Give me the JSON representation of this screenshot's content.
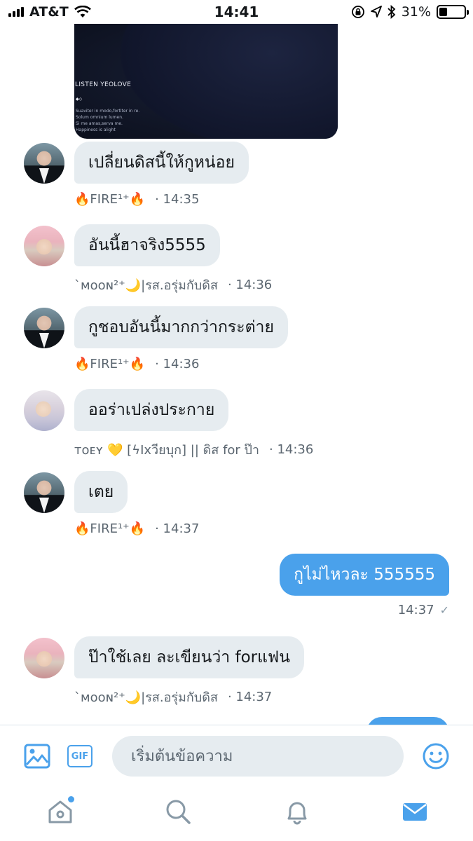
{
  "status_bar": {
    "carrier": "AT&T",
    "time": "14:41",
    "battery_text": "31%",
    "battery_level": 0.31,
    "icons": [
      "signal-bars-icon",
      "wifi-icon",
      "orientation-lock-icon",
      "location-arrow-icon",
      "bluetooth-icon",
      "battery-icon"
    ]
  },
  "media": {
    "title": "LISTEN YEOLOVE",
    "dots": "◆◇",
    "lines": [
      "Suaviter in modo,fortiter in re.",
      "Solum omnium lumen.",
      "Si me amas,serva me.",
      "Happiness is alight"
    ]
  },
  "messages": [
    {
      "text": "เปลี่ยนดิสนี้ให้กูหน่อย",
      "sender": "🔥FIRE¹⁺🔥",
      "time": "· 14:35",
      "avatar": "fire"
    },
    {
      "text": "อันนี้ฮาจริง5555",
      "sender": "`ᴍᴏᴏɴ²⁺🌙|รส.อรุ่มกับดิส",
      "time": "· 14:36",
      "avatar": "moon"
    },
    {
      "text": "กูชอบอันนี้มากกว่ากระต่าย",
      "sender": "🔥FIRE¹⁺🔥",
      "time": "· 14:36",
      "avatar": "fire"
    },
    {
      "text": "ออร่าเปล่งประกาย",
      "sender": "ᴛᴏᴇʏ 💛 [ϟIxวียบุก] || ดิส for ป๊า",
      "time": "· 14:36",
      "avatar": "toey"
    },
    {
      "text": "เตย",
      "sender": "🔥FIRE¹⁺🔥",
      "time": "· 14:37",
      "avatar": "fire"
    },
    {
      "text": "กูไม่ไหวละ 555555",
      "outgoing": true,
      "time": "14:37",
      "tick": "✓"
    },
    {
      "text": "ป๊าใช้เลย ละเขียนว่า forแฟน",
      "sender": "`ᴍᴏᴏɴ²⁺🌙|รส.อรุ่มกับดิส",
      "time": "· 14:37",
      "avatar": "moon"
    }
  ],
  "compose": {
    "placeholder": "เริ่มต้นข้อความ",
    "gif_label": "GIF",
    "icons": [
      "image-icon",
      "gif-icon",
      "emoji-icon"
    ]
  },
  "tabbar": {
    "tabs": [
      "home",
      "search",
      "notifications",
      "messages"
    ],
    "active": "messages",
    "unread_home": true
  },
  "colors": {
    "accent": "#4aa1eb",
    "incoming_bubble": "#e6ecf0",
    "meta_text": "#5b6670",
    "icon_gray": "#8899a6"
  }
}
